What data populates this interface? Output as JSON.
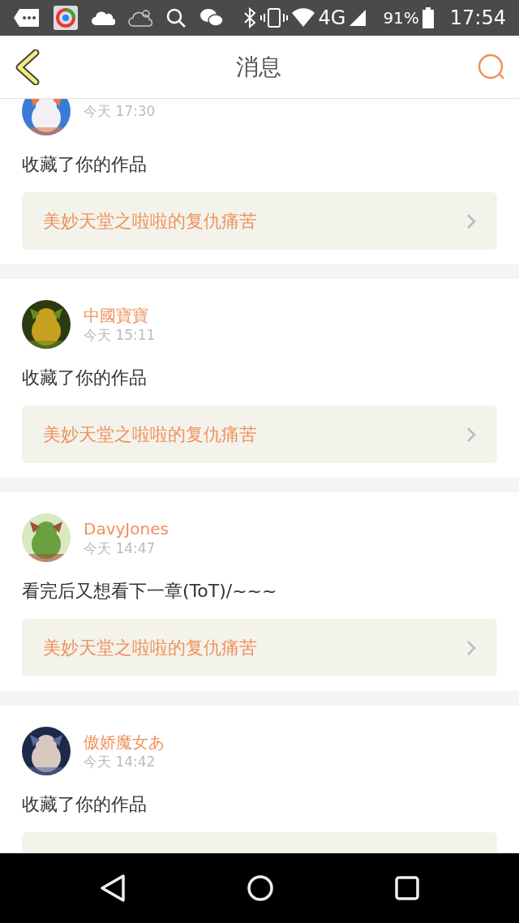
{
  "status_bar": {
    "network": "4G",
    "battery": "91%",
    "time": "17:54"
  },
  "header": {
    "title": "消息"
  },
  "messages": [
    {
      "time": "今天 17:30",
      "text": "收藏了你的作品",
      "work": "美妙天堂之啦啦的复仇痛苦"
    },
    {
      "user": "中國寶寶",
      "time": "今天 15:11",
      "text": "收藏了你的作品",
      "work": "美妙天堂之啦啦的复仇痛苦"
    },
    {
      "user": "DavyJones",
      "time": "今天 14:47",
      "text": "看完后又想看下一章(ToT)/~~~",
      "work": "美妙天堂之啦啦的复仇痛苦"
    },
    {
      "user": "傲娇魔女あ",
      "time": "今天 14:42",
      "text": "收藏了你的作品"
    }
  ]
}
